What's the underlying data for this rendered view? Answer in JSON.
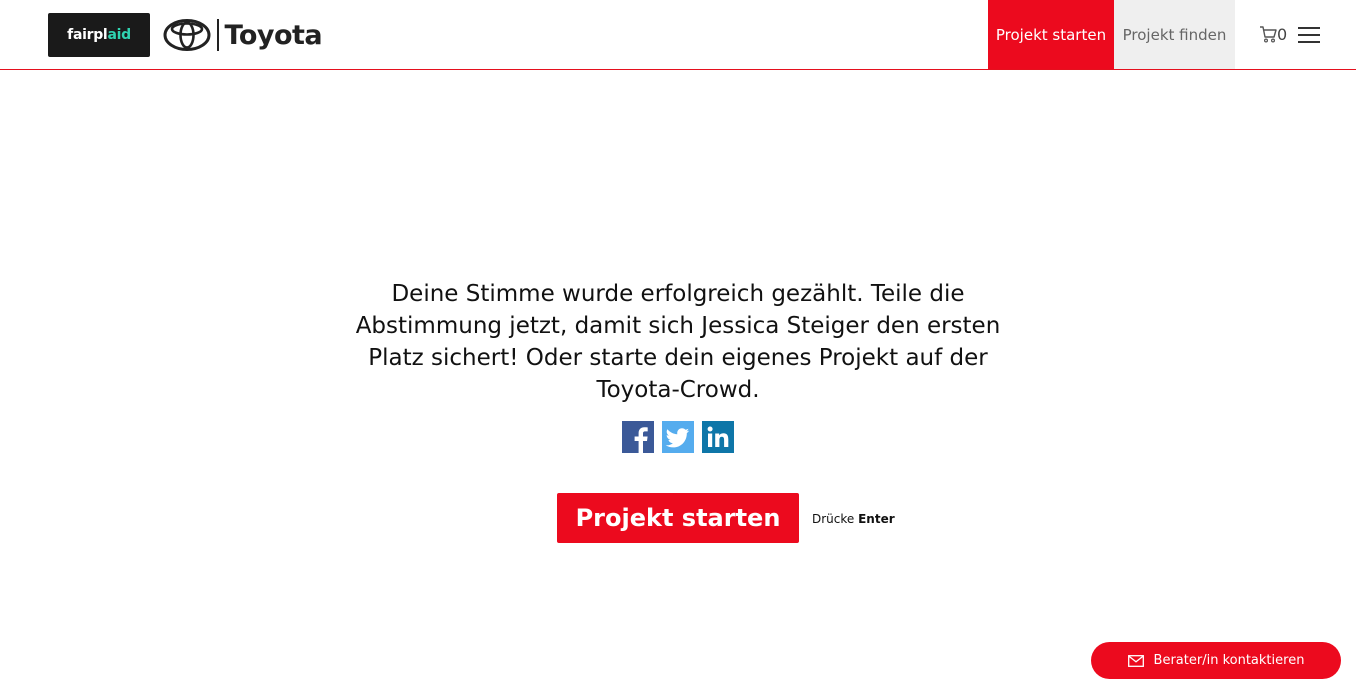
{
  "header": {
    "logo_fairplaid_a": "fairpl",
    "logo_fairplaid_b": "aid",
    "logo_toyota": "Toyota",
    "nav_start": "Projekt starten",
    "nav_find": "Projekt finden",
    "cart_count": "0"
  },
  "main": {
    "message": "Deine Stimme wurde erfolgreich gezählt. Teile die Abstimmung jetzt, damit sich Jessica Steiger den ersten Platz sichert! Oder starte dein eigenes Projekt auf der Toyota-Crowd.",
    "share_icons": [
      "facebook-icon",
      "twitter-icon",
      "linkedin-icon"
    ],
    "cta_label": "Projekt starten",
    "hint_prefix": "Drücke",
    "hint_key": "Enter"
  },
  "contact": {
    "label": "Berater/in kontaktieren"
  },
  "colors": {
    "brand_red": "#ec0a1e",
    "facebook": "#3b5998",
    "twitter": "#55acee",
    "linkedin": "#0e76a8"
  }
}
